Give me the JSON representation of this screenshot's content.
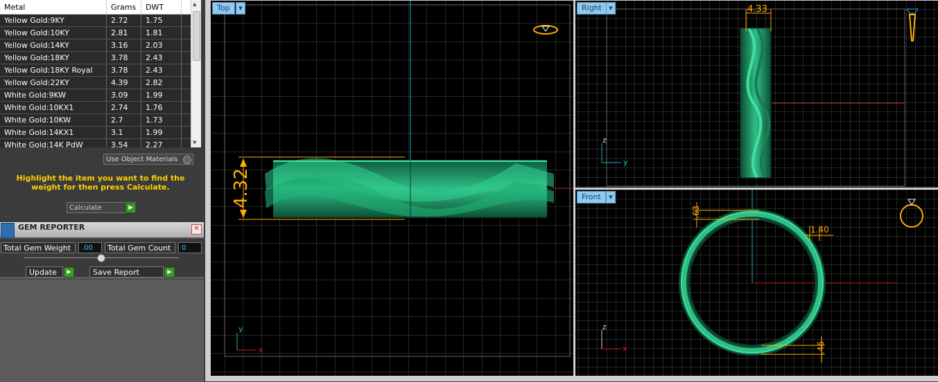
{
  "metal_table": {
    "headers": [
      "Metal",
      "Grams",
      "DWT"
    ],
    "rows": [
      [
        "Yellow Gold:9KY",
        "2.72",
        "1.75"
      ],
      [
        "Yellow Gold:10KY",
        "2.81",
        "1.81"
      ],
      [
        "Yellow Gold:14KY",
        "3.16",
        "2.03"
      ],
      [
        "Yellow Gold:18KY",
        "3.78",
        "2.43"
      ],
      [
        "Yellow Gold:18KY Royal",
        "3.78",
        "2.43"
      ],
      [
        "Yellow Gold:22KY",
        "4.39",
        "2.82"
      ],
      [
        "White Gold:9KW",
        "3.09",
        "1.99"
      ],
      [
        "White Gold:10KX1",
        "2.74",
        "1.76"
      ],
      [
        "White Gold:10KW",
        "2.7",
        "1.73"
      ],
      [
        "White Gold:14KX1",
        "3.1",
        "1.99"
      ],
      [
        "White Gold:14K PdW",
        "3.54",
        "2.27"
      ]
    ]
  },
  "use_object_materials": "Use Object Materials",
  "hint": "Highlight the item you want to find the weight for then press Calculate.",
  "calculate_label": "Calculate",
  "gem_reporter": {
    "title": "GEM REPORTER",
    "total_weight_label": "Total Gem Weight",
    "total_weight_value": ".00",
    "total_count_label": "Total Gem Count",
    "total_count_value": "0",
    "update_label": "Update",
    "save_report_label": "Save Report"
  },
  "viewports": {
    "top": {
      "label": "Top",
      "dimension": "4.32",
      "axis_y": "y",
      "axis_x": "x"
    },
    "right": {
      "label": "Right",
      "dimension": "4.33",
      "axis_z": "z",
      "axis_y": "y"
    },
    "front": {
      "label": "Front",
      "dim_a": ".63",
      "dim_b": "1.40",
      "dim_c": ".46",
      "axis_z": "z",
      "axis_x": "x"
    }
  },
  "colors": {
    "ring": "#1f8a5e",
    "dimension": "#ffb000",
    "axis_red": "#d02020",
    "axis_cyan": "#20b0c8"
  }
}
